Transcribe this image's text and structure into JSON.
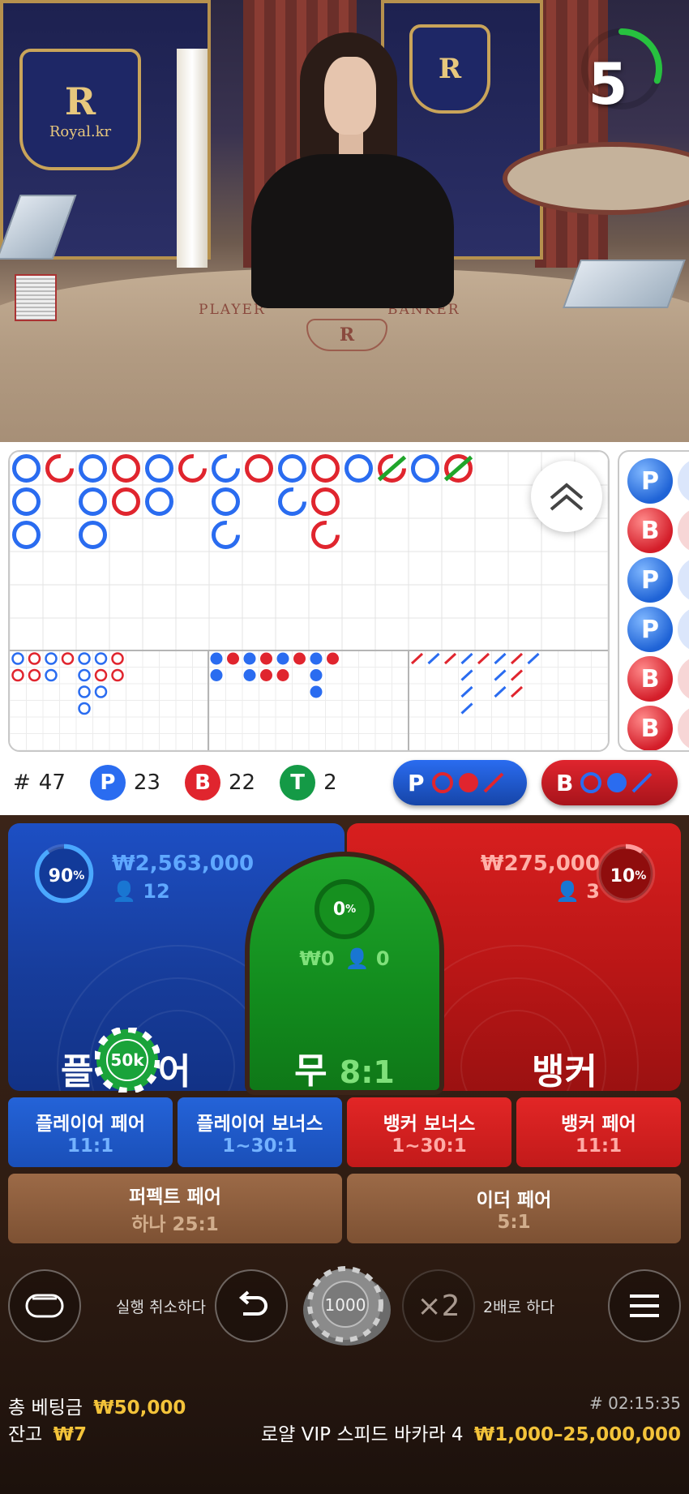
{
  "video": {
    "crest_text": "Royal.kr",
    "crest_letter": "R",
    "felt_player": "PLAYER",
    "felt_banker": "BANKER"
  },
  "timer": {
    "seconds": "5",
    "progress": 0.3,
    "color": "#27c13f"
  },
  "roadmap": {
    "big_road": [
      [
        [
          "P"
        ],
        [
          "P"
        ],
        [
          "P"
        ]
      ],
      [
        [
          "B",
          "partial"
        ]
      ],
      [
        [
          "P"
        ],
        [
          "P"
        ],
        [
          "P"
        ]
      ],
      [
        [
          "B"
        ],
        [
          "B"
        ]
      ],
      [
        [
          "P"
        ],
        [
          "P"
        ]
      ],
      [
        [
          "B",
          "partial"
        ]
      ],
      [
        [
          "P",
          "partial"
        ],
        [
          "P"
        ],
        [
          "P",
          "partial"
        ]
      ],
      [
        [
          "B"
        ]
      ],
      [
        [
          "P"
        ],
        [
          "P",
          "partial"
        ]
      ],
      [
        [
          "B"
        ],
        [
          "B"
        ],
        [
          "B",
          "partial"
        ]
      ],
      [
        [
          "P"
        ]
      ],
      [
        [
          "B",
          "tie-partial"
        ]
      ],
      [
        [
          "P"
        ]
      ],
      [
        [
          "B",
          "tie"
        ]
      ]
    ],
    "small_road_1": [
      [
        "P",
        "B"
      ],
      [
        "B",
        "B"
      ],
      [
        "P",
        "P"
      ],
      [
        "B"
      ],
      [
        "P",
        "P",
        "P",
        "P"
      ],
      [
        "P",
        "B",
        "P"
      ],
      [
        "B",
        "B"
      ]
    ],
    "small_road_2": [
      [
        "P",
        "P"
      ],
      [
        "B"
      ],
      [
        "P",
        "P"
      ],
      [
        "B",
        "B"
      ],
      [
        "P",
        "B"
      ],
      [
        "B"
      ],
      [
        "P",
        "P",
        "P"
      ],
      [
        "B"
      ]
    ],
    "small_road_3": [
      [
        "B"
      ],
      [
        "P"
      ],
      [
        "B"
      ],
      [
        "P",
        "P",
        "P",
        "P"
      ],
      [
        "B"
      ],
      [
        "P",
        "P",
        "P"
      ],
      [
        "B",
        "B",
        "B"
      ],
      [
        "P"
      ]
    ],
    "side_beads": [
      "P",
      "B",
      "P",
      "P",
      "B",
      "B"
    ]
  },
  "stats": {
    "hash": "#",
    "rounds": "47",
    "player_letter": "P",
    "player_count": "23",
    "banker_letter": "B",
    "banker_count": "22",
    "tie_letter": "T",
    "tie_count": "2"
  },
  "predict": {
    "player_letter": "P",
    "banker_letter": "B"
  },
  "player": {
    "percent_num": "90",
    "percent_sign": "%",
    "percent": 0.9,
    "amount": "₩2,563,000",
    "users": "12",
    "label_left": "플",
    "label_right": "어",
    "chip": "50k"
  },
  "tie": {
    "percent_num": "0",
    "percent_sign": "%",
    "amount": "₩0",
    "users": "0",
    "label": "무",
    "odds": "8:1"
  },
  "banker": {
    "percent_num": "10",
    "percent_sign": "%",
    "percent": 0.1,
    "amount": "₩275,000",
    "users": "3",
    "label": "뱅커"
  },
  "side_bets": [
    {
      "name": "플레이어 페어",
      "odds": "11:1"
    },
    {
      "name": "플레이어 보너스",
      "odds": "1~30:1"
    },
    {
      "name": "뱅커 보너스",
      "odds": "1~30:1"
    },
    {
      "name": "뱅커 페어",
      "odds": "11:1"
    }
  ],
  "pair_bets": [
    {
      "name": "퍼펙트 페어",
      "odds": "하나 25:1"
    },
    {
      "name": "이더 페어",
      "odds": "5:1"
    }
  ],
  "controls": {
    "undo_label": "실행 취소하다",
    "chip_value": "1000",
    "double_symbol": "×2",
    "double_label": "2배로 하다"
  },
  "footer": {
    "total_bet_label": "총 베팅금",
    "total_bet": "₩50,000",
    "balance_label": "잔고",
    "balance": "₩7",
    "round_id": "# 02:15:35",
    "table_name": "로얄 VIP 스피드 바카라 4",
    "limits": "₩1,000–25,000,000"
  },
  "colors": {
    "player": "#2a6cf0",
    "banker": "#e0252e",
    "tie": "#1fa52b",
    "gold": "#f3c33a"
  }
}
